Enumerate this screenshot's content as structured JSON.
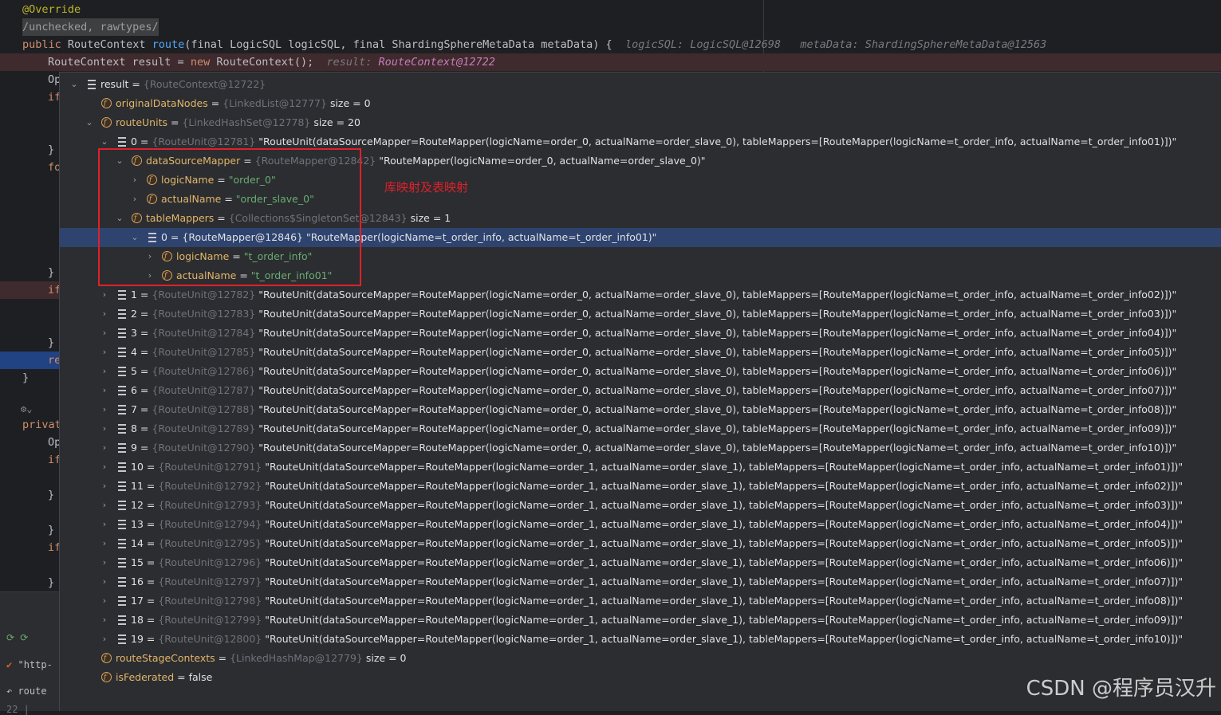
{
  "code": {
    "annotation": "@Override",
    "comment": "/unchecked, rawtypes/",
    "signature_keyword": "public",
    "signature_type": "RouteContext",
    "signature_method": "route",
    "signature_params_1": "(final LogicSQL logicSQL, final ShardingSphereMetaData metaData) {",
    "inline_hint_1": "logicSQL: LogicSQL@12698",
    "inline_hint_2": "metaData: ShardingSphereMetaData@12563",
    "line_result_prefix": "RouteContext result = ",
    "line_result_new": "new",
    "line_result_suffix": " RouteContext();",
    "inline_result_label": "result: ",
    "inline_result_value": "RouteContext@12722",
    "stub_op": "Op",
    "stub_if": "if",
    "stub_for": "fo",
    "stub_brace": "}",
    "stub_re": "re",
    "stub_private": "privat",
    "stub_if2": "if",
    "stub_op2": "Op"
  },
  "bottom_panel": {
    "item_http": "\"http-",
    "item_route": "route",
    "item_number": "22 |"
  },
  "tree": {
    "root": {
      "name": "result",
      "ref": "{RouteContext@12722}"
    },
    "originalDataNodes": {
      "name": "originalDataNodes",
      "ref": "{LinkedList@12777}",
      "extra": "size = 0"
    },
    "routeUnits": {
      "name": "routeUnits",
      "ref": "{LinkedHashSet@12778}",
      "extra": "size = 20"
    },
    "unit0": {
      "index": "0",
      "ref": "{RouteUnit@12781}",
      "value": "\"RouteUnit(dataSourceMapper=RouteMapper(logicName=order_0, actualName=order_slave_0), tableMappers=[RouteMapper(logicName=t_order_info, actualName=t_order_info01)])\""
    },
    "dataSourceMapper": {
      "name": "dataSourceMapper",
      "ref": "{RouteMapper@12842}",
      "value": "\"RouteMapper(logicName=order_0, actualName=order_slave_0)\""
    },
    "ds_logicName": {
      "name": "logicName",
      "value": "\"order_0\""
    },
    "ds_actualName": {
      "name": "actualName",
      "value": "\"order_slave_0\""
    },
    "tableMappers": {
      "name": "tableMappers",
      "ref": "{Collections$SingletonSet@12843}",
      "extra": "size = 1"
    },
    "tm0": {
      "text": "0 = {RouteMapper@12846} \"RouteMapper(logicName=t_order_info, actualName=t_order_info01)\""
    },
    "tm_logicName": {
      "name": "logicName",
      "value": "\"t_order_info\""
    },
    "tm_actualName": {
      "name": "actualName",
      "value": "\"t_order_info01\""
    },
    "units": [
      {
        "index": "1",
        "ref": "{RouteUnit@12782}",
        "value": "\"RouteUnit(dataSourceMapper=RouteMapper(logicName=order_0, actualName=order_slave_0), tableMappers=[RouteMapper(logicName=t_order_info, actualName=t_order_info02)])\""
      },
      {
        "index": "2",
        "ref": "{RouteUnit@12783}",
        "value": "\"RouteUnit(dataSourceMapper=RouteMapper(logicName=order_0, actualName=order_slave_0), tableMappers=[RouteMapper(logicName=t_order_info, actualName=t_order_info03)])\""
      },
      {
        "index": "3",
        "ref": "{RouteUnit@12784}",
        "value": "\"RouteUnit(dataSourceMapper=RouteMapper(logicName=order_0, actualName=order_slave_0), tableMappers=[RouteMapper(logicName=t_order_info, actualName=t_order_info04)])\""
      },
      {
        "index": "4",
        "ref": "{RouteUnit@12785}",
        "value": "\"RouteUnit(dataSourceMapper=RouteMapper(logicName=order_0, actualName=order_slave_0), tableMappers=[RouteMapper(logicName=t_order_info, actualName=t_order_info05)])\""
      },
      {
        "index": "5",
        "ref": "{RouteUnit@12786}",
        "value": "\"RouteUnit(dataSourceMapper=RouteMapper(logicName=order_0, actualName=order_slave_0), tableMappers=[RouteMapper(logicName=t_order_info, actualName=t_order_info06)])\""
      },
      {
        "index": "6",
        "ref": "{RouteUnit@12787}",
        "value": "\"RouteUnit(dataSourceMapper=RouteMapper(logicName=order_0, actualName=order_slave_0), tableMappers=[RouteMapper(logicName=t_order_info, actualName=t_order_info07)])\""
      },
      {
        "index": "7",
        "ref": "{RouteUnit@12788}",
        "value": "\"RouteUnit(dataSourceMapper=RouteMapper(logicName=order_0, actualName=order_slave_0), tableMappers=[RouteMapper(logicName=t_order_info, actualName=t_order_info08)])\""
      },
      {
        "index": "8",
        "ref": "{RouteUnit@12789}",
        "value": "\"RouteUnit(dataSourceMapper=RouteMapper(logicName=order_0, actualName=order_slave_0), tableMappers=[RouteMapper(logicName=t_order_info, actualName=t_order_info09)])\""
      },
      {
        "index": "9",
        "ref": "{RouteUnit@12790}",
        "value": "\"RouteUnit(dataSourceMapper=RouteMapper(logicName=order_0, actualName=order_slave_0), tableMappers=[RouteMapper(logicName=t_order_info, actualName=t_order_info10)])\""
      },
      {
        "index": "10",
        "ref": "{RouteUnit@12791}",
        "value": "\"RouteUnit(dataSourceMapper=RouteMapper(logicName=order_1, actualName=order_slave_1), tableMappers=[RouteMapper(logicName=t_order_info, actualName=t_order_info01)])\""
      },
      {
        "index": "11",
        "ref": "{RouteUnit@12792}",
        "value": "\"RouteUnit(dataSourceMapper=RouteMapper(logicName=order_1, actualName=order_slave_1), tableMappers=[RouteMapper(logicName=t_order_info, actualName=t_order_info02)])\""
      },
      {
        "index": "12",
        "ref": "{RouteUnit@12793}",
        "value": "\"RouteUnit(dataSourceMapper=RouteMapper(logicName=order_1, actualName=order_slave_1), tableMappers=[RouteMapper(logicName=t_order_info, actualName=t_order_info03)])\""
      },
      {
        "index": "13",
        "ref": "{RouteUnit@12794}",
        "value": "\"RouteUnit(dataSourceMapper=RouteMapper(logicName=order_1, actualName=order_slave_1), tableMappers=[RouteMapper(logicName=t_order_info, actualName=t_order_info04)])\""
      },
      {
        "index": "14",
        "ref": "{RouteUnit@12795}",
        "value": "\"RouteUnit(dataSourceMapper=RouteMapper(logicName=order_1, actualName=order_slave_1), tableMappers=[RouteMapper(logicName=t_order_info, actualName=t_order_info05)])\""
      },
      {
        "index": "15",
        "ref": "{RouteUnit@12796}",
        "value": "\"RouteUnit(dataSourceMapper=RouteMapper(logicName=order_1, actualName=order_slave_1), tableMappers=[RouteMapper(logicName=t_order_info, actualName=t_order_info06)])\""
      },
      {
        "index": "16",
        "ref": "{RouteUnit@12797}",
        "value": "\"RouteUnit(dataSourceMapper=RouteMapper(logicName=order_1, actualName=order_slave_1), tableMappers=[RouteMapper(logicName=t_order_info, actualName=t_order_info07)])\""
      },
      {
        "index": "17",
        "ref": "{RouteUnit@12798}",
        "value": "\"RouteUnit(dataSourceMapper=RouteMapper(logicName=order_1, actualName=order_slave_1), tableMappers=[RouteMapper(logicName=t_order_info, actualName=t_order_info08)])\""
      },
      {
        "index": "18",
        "ref": "{RouteUnit@12799}",
        "value": "\"RouteUnit(dataSourceMapper=RouteMapper(logicName=order_1, actualName=order_slave_1), tableMappers=[RouteMapper(logicName=t_order_info, actualName=t_order_info09)])\""
      },
      {
        "index": "19",
        "ref": "{RouteUnit@12800}",
        "value": "\"RouteUnit(dataSourceMapper=RouteMapper(logicName=order_1, actualName=order_slave_1), tableMappers=[RouteMapper(logicName=t_order_info, actualName=t_order_info10)])\""
      }
    ],
    "routeStageContexts": {
      "name": "routeStageContexts",
      "ref": "{LinkedHashMap@12779}",
      "extra": "size = 0"
    },
    "isFederated": {
      "name": "isFederated",
      "value": "false"
    }
  },
  "annotation_note": "库映射及表映射",
  "watermark": "CSDN @程序员汉升",
  "colors": {
    "highlight_box": "#e0202b",
    "selected_row": "#2e436e",
    "string_value": "#6aab73",
    "field_name": "#e3b56b"
  }
}
